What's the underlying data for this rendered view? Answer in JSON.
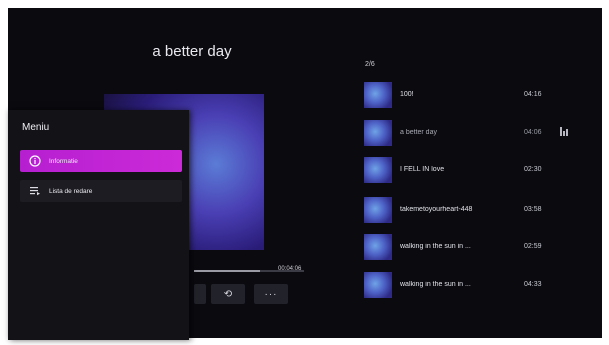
{
  "player": {
    "title": "a better day",
    "total_time": "00:04:06",
    "progress_fraction": 0.6,
    "controls": [
      {
        "id": "repeat",
        "icon": "repeat-icon",
        "glyph": "⟲"
      },
      {
        "id": "more",
        "icon": "more-icon",
        "glyph": "···"
      }
    ]
  },
  "menu": {
    "title": "Meniu",
    "items": [
      {
        "label": "Informatie",
        "icon": "info-icon",
        "active": true
      },
      {
        "label": "Lista de redare",
        "icon": "playlist-icon",
        "active": false
      }
    ]
  },
  "queue": {
    "position": "2/6",
    "tracks": [
      {
        "name": "100!",
        "duration": "04:16",
        "current": false
      },
      {
        "name": "a better day",
        "duration": "04:06",
        "current": true
      },
      {
        "name": "I FELL IN love",
        "duration": "02:30",
        "current": false
      },
      {
        "name": "takemetoyourheart-448",
        "duration": "03:58",
        "current": false
      },
      {
        "name": "walking in the sun in ...",
        "duration": "02:59",
        "current": false
      },
      {
        "name": "walking in the sun in ...",
        "duration": "04:33",
        "current": false
      }
    ]
  },
  "colors": {
    "background": "#0a0a0f",
    "accent": "#c026d3",
    "menu_bg": "#121217"
  }
}
